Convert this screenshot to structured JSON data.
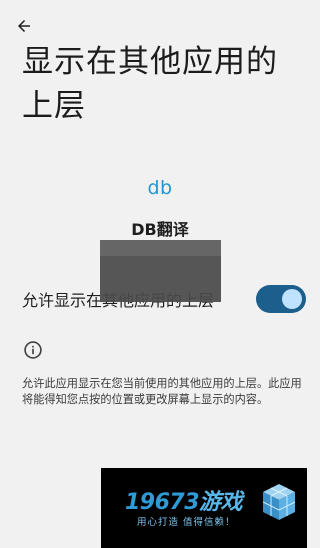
{
  "header": {
    "back_icon": "arrow-left-icon",
    "title": "显示在其他应用的上层"
  },
  "app": {
    "icon_text": "db",
    "icon_color": "#2196d3",
    "name": "DB翻译"
  },
  "setting": {
    "label": "允许显示在其他应用的上层",
    "enabled": true,
    "toggle_track_color": "#1d5f8c",
    "toggle_knob_color": "#bfe3ff"
  },
  "info": {
    "icon": "info-circle-icon",
    "description": "允许此应用显示在您当前使用的其他应用的上层。此应用将能得知您点按的位置或更改屏幕上显示的内容。"
  },
  "watermark": {
    "number": "19673",
    "site_suffix": "游戏",
    "slogan": "用心打造 值得信赖！",
    "logo_icon": "cube-logo-icon"
  }
}
